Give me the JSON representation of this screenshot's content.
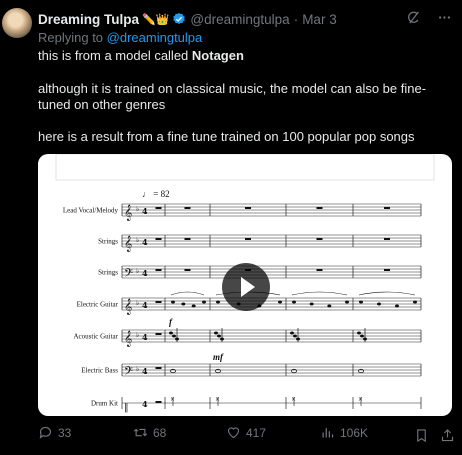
{
  "author": {
    "name": "Dreaming Tulpa",
    "emoji": "✏️👑",
    "handle": "@dreamingtulpa",
    "separator": "·",
    "date": "Mar 3"
  },
  "reply": {
    "prefix": "Replying to",
    "mention": "@dreamingtulpa"
  },
  "text": {
    "line1_prefix": "this is from a model called ",
    "line1_bold": "Notagen",
    "paragraph2": "although it is trained on classical music, the model can also be fine-tuned on other genres",
    "paragraph3": "here is a result from a fine tune trained on 100 popular pop songs"
  },
  "media": {
    "tempo": "♩ = 82",
    "dynamic_f": "f",
    "dynamic_mf": "mf",
    "instruments": [
      "Lead Vocal/Melody",
      "Strings",
      "Strings",
      "Electric Guitar",
      "Acoustic Guitar",
      "Electric Bass",
      "Drum Kit"
    ],
    "play_button": "play"
  },
  "actions": {
    "replies": "33",
    "reposts": "68",
    "likes": "417",
    "views": "106K"
  },
  "colors": {
    "background": "#000000",
    "text": "#e7e9ea",
    "muted": "#71767b",
    "accent": "#1d9bf0"
  }
}
